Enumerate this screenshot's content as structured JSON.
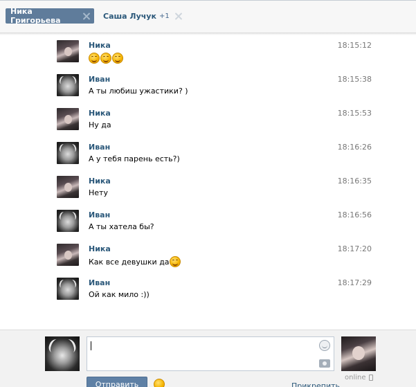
{
  "tabs": [
    {
      "label": "Ника Григорьева",
      "active": true
    },
    {
      "label": "Саша Лучук",
      "badge": "+1",
      "active": false
    }
  ],
  "messages": [
    {
      "author": "Ника",
      "time": "18:15:12",
      "text": "",
      "emoji_count": 3,
      "avatar": "nika"
    },
    {
      "author": "Иван",
      "time": "18:15:38",
      "text": "А ты любиш ужастики? )",
      "avatar": "ivan"
    },
    {
      "author": "Ника",
      "time": "18:15:53",
      "text": "Ну да",
      "avatar": "nika"
    },
    {
      "author": "Иван",
      "time": "18:16:26",
      "text": "А у тебя парень есть?)",
      "avatar": "ivan"
    },
    {
      "author": "Ника",
      "time": "18:16:35",
      "text": "Нету",
      "avatar": "nika"
    },
    {
      "author": "Иван",
      "time": "18:16:56",
      "text": "А ты хатела бы?",
      "avatar": "ivan"
    },
    {
      "author": "Ника",
      "time": "18:17:20",
      "text": "Как все девушки да",
      "emoji_count": 1,
      "avatar": "nika"
    },
    {
      "author": "Иван",
      "time": "18:17:29",
      "text": "Ой как мило :))",
      "avatar": "ivan"
    }
  ],
  "composer": {
    "send_label": "Отправить",
    "attach_label": "Прикрепить",
    "online_label": "online"
  },
  "colors": {
    "accent": "#5f7c9b",
    "link": "#2b587a",
    "time": "#777777"
  },
  "icons": {
    "tab_close": "close-icon",
    "emoji": "smiley-icon",
    "camera": "camera-icon",
    "mobile": "phone-icon"
  }
}
